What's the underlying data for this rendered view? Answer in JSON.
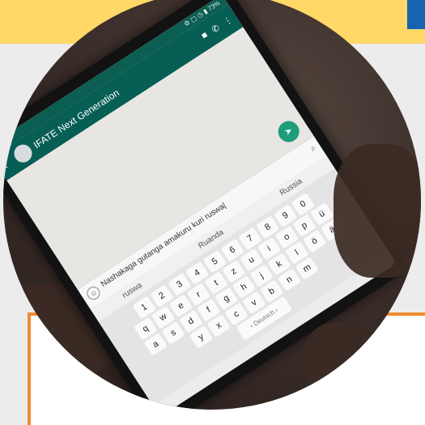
{
  "page": {
    "colors": {
      "banner": "#ffd867",
      "accent": "#1763b0",
      "frame": "#f28a2e"
    }
  },
  "phone": {
    "status_text": "⚙ ▢ ◷ ▮ 73%",
    "chat_title": "IFATE Next Generation",
    "icons": {
      "back": "back-icon",
      "video": "video-icon",
      "call": "phone-icon",
      "menu": "more-icon",
      "send": "send-icon",
      "emoji": "emoji-icon",
      "attach": "paperclip-icon"
    },
    "message": "Nashakaga gutanga amakuru kuri ruswa|",
    "suggestions": [
      "ruswa",
      "Ruanda",
      "Russia"
    ],
    "keyboard": {
      "row1": [
        "1",
        "2",
        "3",
        "4",
        "5",
        "6",
        "7",
        "8",
        "9",
        "0"
      ],
      "row2": [
        "q",
        "w",
        "e",
        "r",
        "t",
        "z",
        "u",
        "i",
        "o",
        "p",
        "ü"
      ],
      "row3": [
        "a",
        "s",
        "d",
        "f",
        "g",
        "h",
        "j",
        "k",
        "l",
        "ö",
        "ä"
      ],
      "row4": [
        "y",
        "x",
        "c",
        "v",
        "b",
        "n",
        "m"
      ],
      "space_label": "‹ Deutsch ›"
    }
  }
}
